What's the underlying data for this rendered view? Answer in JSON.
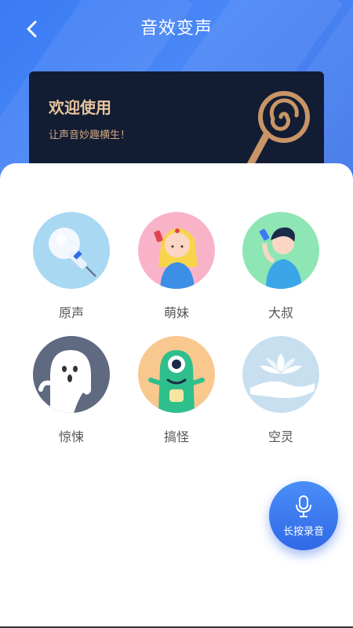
{
  "header": {
    "title": "音效变声"
  },
  "banner": {
    "title": "欢迎使用",
    "subtitle": "让声音妙趣横生！"
  },
  "effects": [
    {
      "label": "原声"
    },
    {
      "label": "萌妹"
    },
    {
      "label": "大叔"
    },
    {
      "label": "惊悚"
    },
    {
      "label": "搞怪"
    },
    {
      "label": "空灵"
    }
  ],
  "record": {
    "label": "长按录音"
  }
}
